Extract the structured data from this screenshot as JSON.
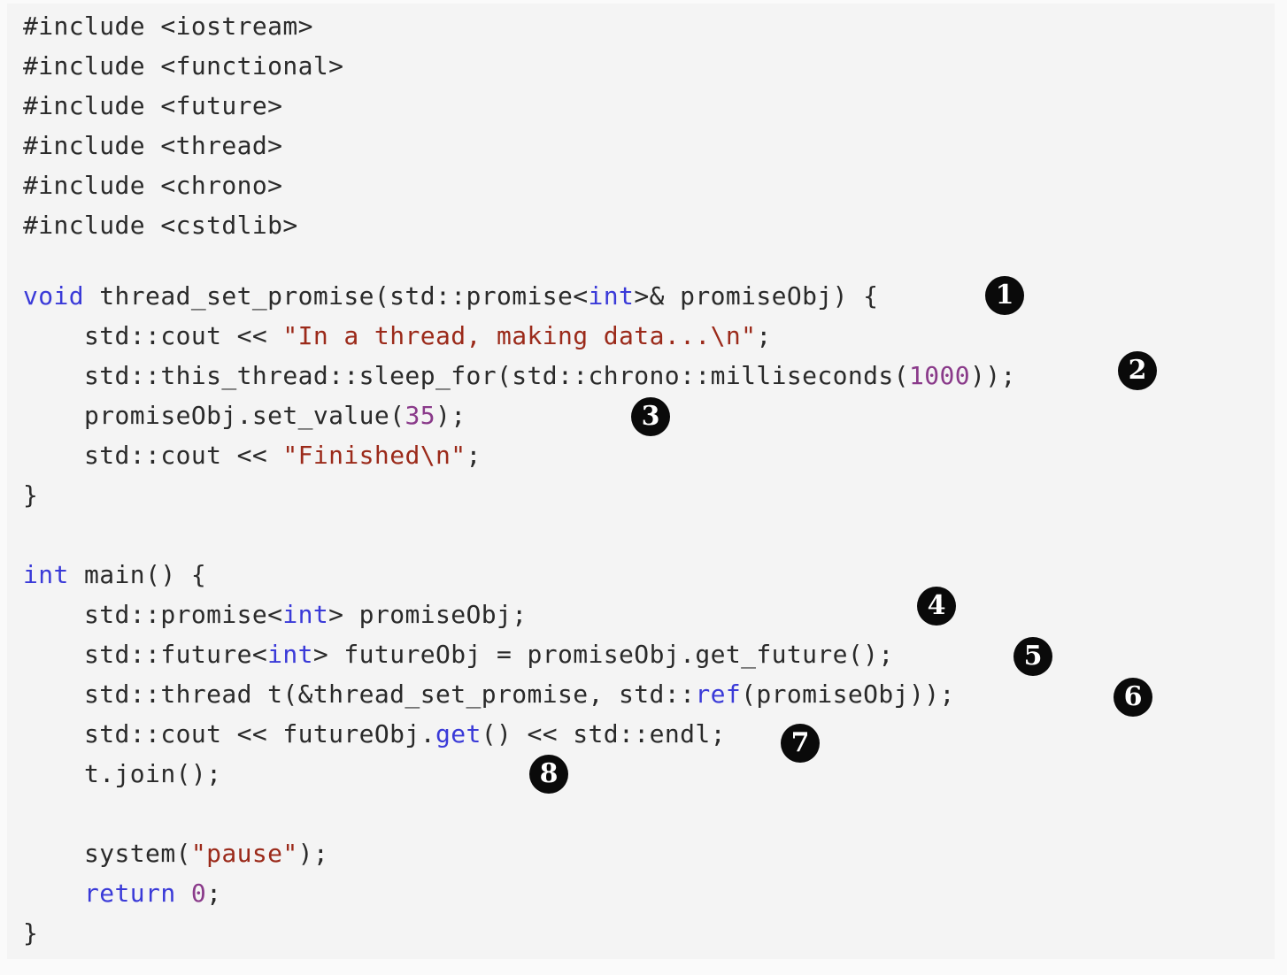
{
  "code": {
    "lines": [
      {
        "tokens": [
          {
            "t": "#include <iostream>",
            "c": "plain"
          }
        ]
      },
      {
        "tokens": [
          {
            "t": "#include <functional>",
            "c": "plain"
          }
        ]
      },
      {
        "tokens": [
          {
            "t": "#include <future>",
            "c": "plain"
          }
        ]
      },
      {
        "tokens": [
          {
            "t": "#include <thread>",
            "c": "plain"
          }
        ]
      },
      {
        "tokens": [
          {
            "t": "#include <chrono>",
            "c": "plain"
          }
        ]
      },
      {
        "tokens": [
          {
            "t": "#include <cstdlib>",
            "c": "plain"
          }
        ]
      },
      {
        "tokens": []
      },
      {
        "tokens": [
          {
            "t": "void",
            "c": "kw"
          },
          {
            "t": " thread_set_promise(std::promise<",
            "c": "plain"
          },
          {
            "t": "int",
            "c": "kw"
          },
          {
            "t": ">& promiseObj) {",
            "c": "plain"
          }
        ]
      },
      {
        "tokens": [
          {
            "t": "    std::cout << ",
            "c": "plain"
          },
          {
            "t": "\"In a thread, making data...\\n\"",
            "c": "str"
          },
          {
            "t": ";",
            "c": "plain"
          }
        ]
      },
      {
        "tokens": [
          {
            "t": "    std::this_thread::sleep_for(std::chrono::milliseconds(",
            "c": "plain"
          },
          {
            "t": "1000",
            "c": "num"
          },
          {
            "t": "));",
            "c": "plain"
          }
        ]
      },
      {
        "tokens": [
          {
            "t": "    promiseObj.set_value(",
            "c": "plain"
          },
          {
            "t": "35",
            "c": "num"
          },
          {
            "t": ");",
            "c": "plain"
          }
        ]
      },
      {
        "tokens": [
          {
            "t": "    std::cout << ",
            "c": "plain"
          },
          {
            "t": "\"Finished\\n\"",
            "c": "str"
          },
          {
            "t": ";",
            "c": "plain"
          }
        ]
      },
      {
        "tokens": [
          {
            "t": "}",
            "c": "plain"
          }
        ]
      },
      {
        "tokens": []
      },
      {
        "tokens": [
          {
            "t": "int",
            "c": "kw"
          },
          {
            "t": " main() {",
            "c": "plain"
          }
        ]
      },
      {
        "tokens": [
          {
            "t": "    std::promise<",
            "c": "plain"
          },
          {
            "t": "int",
            "c": "kw"
          },
          {
            "t": "> promiseObj;",
            "c": "plain"
          }
        ]
      },
      {
        "tokens": [
          {
            "t": "    std::future<",
            "c": "plain"
          },
          {
            "t": "int",
            "c": "kw"
          },
          {
            "t": "> futureObj = promiseObj.get_future();",
            "c": "plain"
          }
        ]
      },
      {
        "tokens": [
          {
            "t": "    std::thread t(&thread_set_promise, std::",
            "c": "plain"
          },
          {
            "t": "ref",
            "c": "kw"
          },
          {
            "t": "(promiseObj));",
            "c": "plain"
          }
        ]
      },
      {
        "tokens": [
          {
            "t": "    std::cout << futureObj.",
            "c": "plain"
          },
          {
            "t": "get",
            "c": "kw"
          },
          {
            "t": "() << std::endl;",
            "c": "plain"
          }
        ]
      },
      {
        "tokens": [
          {
            "t": "    t.join();",
            "c": "plain"
          }
        ]
      },
      {
        "tokens": []
      },
      {
        "tokens": [
          {
            "t": "    system(",
            "c": "plain"
          },
          {
            "t": "\"pause\"",
            "c": "str"
          },
          {
            "t": ");",
            "c": "plain"
          }
        ]
      },
      {
        "tokens": [
          {
            "t": "    ",
            "c": "plain"
          },
          {
            "t": "return",
            "c": "kw"
          },
          {
            "t": " ",
            "c": "plain"
          },
          {
            "t": "0",
            "c": "num"
          },
          {
            "t": ";",
            "c": "plain"
          }
        ]
      },
      {
        "tokens": [
          {
            "t": "}",
            "c": "plain"
          }
        ]
      }
    ]
  },
  "markers": [
    {
      "label": "1",
      "glyph": "❶"
    },
    {
      "label": "2",
      "glyph": "❷"
    },
    {
      "label": "3",
      "glyph": "❸"
    },
    {
      "label": "4",
      "glyph": "❹"
    },
    {
      "label": "5",
      "glyph": "❺"
    },
    {
      "label": "6",
      "glyph": "❻"
    },
    {
      "label": "7",
      "glyph": "❼"
    },
    {
      "label": "8",
      "glyph": "❽"
    }
  ],
  "colors": {
    "background": "#f4f4f4",
    "keyword": "#3a3ad8",
    "string": "#9b2a1a",
    "number": "#8a3a8a",
    "plain": "#2a2a2a",
    "marker": "#0a0a0a"
  }
}
